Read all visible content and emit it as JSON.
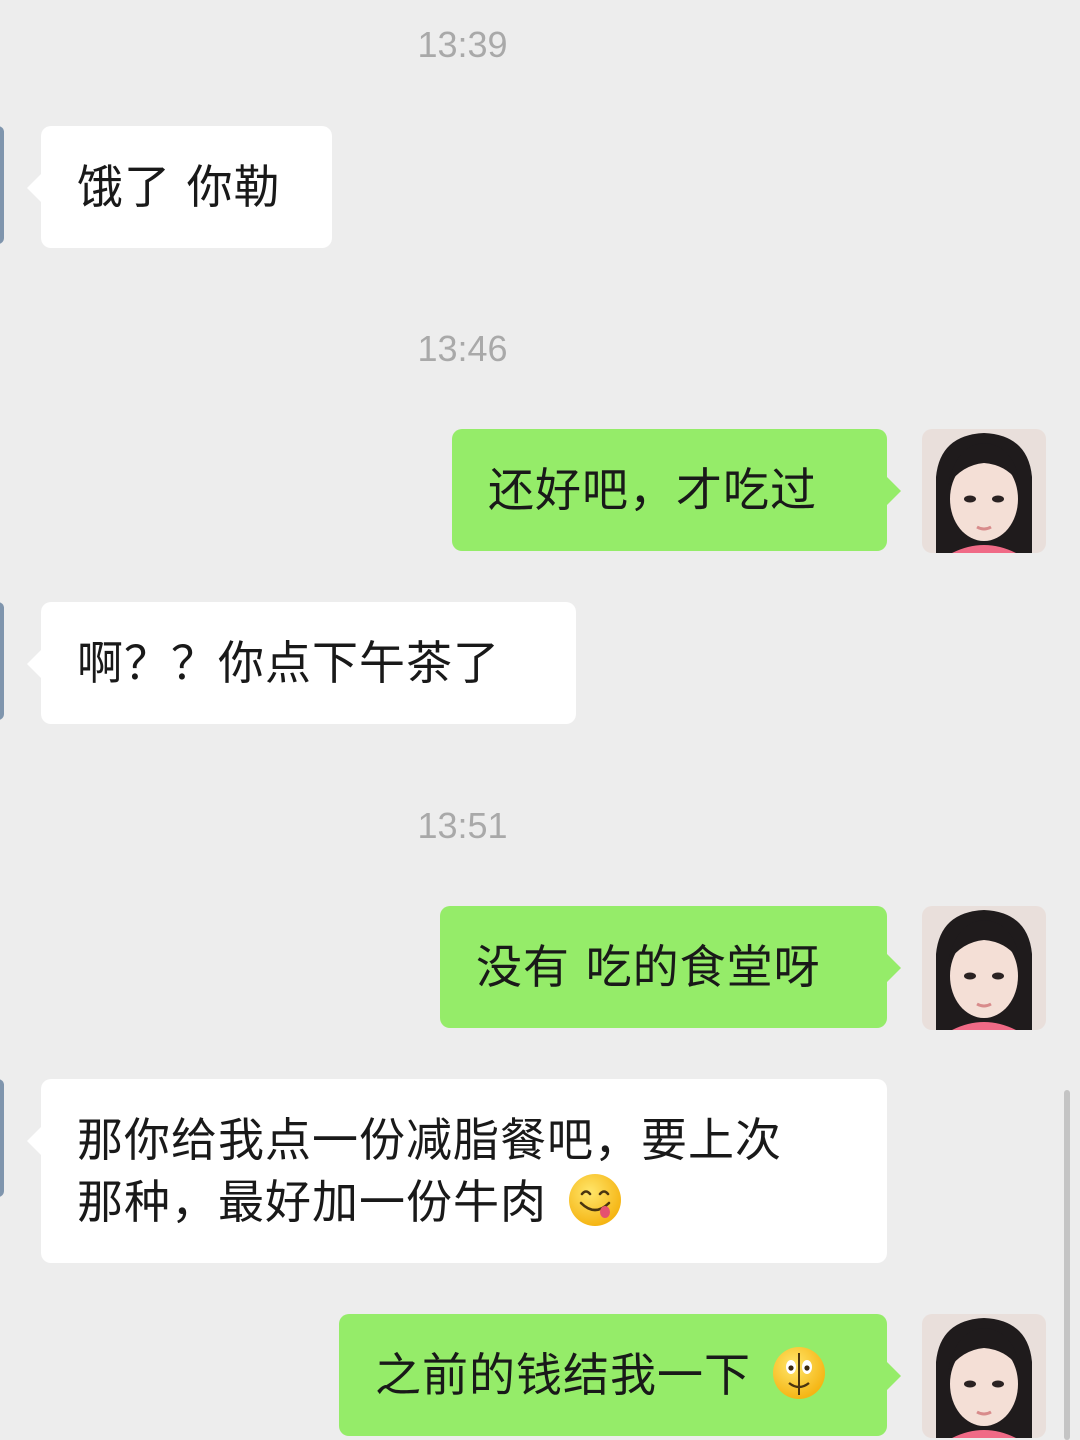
{
  "timestamps": [
    "13:39",
    "13:46",
    "13:51"
  ],
  "messages": [
    {
      "side": "in",
      "text": "饿了 你勒"
    },
    {
      "side": "out",
      "text": "还好吧，才吃过"
    },
    {
      "side": "in",
      "text": "啊？？你点下午茶了"
    },
    {
      "side": "out",
      "text": "没有 吃的食堂呀"
    },
    {
      "side": "in",
      "line1": "那你给我点一份减脂餐吧，要上次",
      "line2": "那种，最好加一份牛肉",
      "emoji": "yum-face-icon"
    },
    {
      "side": "out",
      "text": "之前的钱结我一下",
      "emoji": "zipper-mouth-face-icon"
    }
  ],
  "colors": {
    "background": "#ededed",
    "incoming_bubble": "#ffffff",
    "outgoing_bubble": "#95ec69",
    "timestamp_text": "#a9a9a9"
  }
}
